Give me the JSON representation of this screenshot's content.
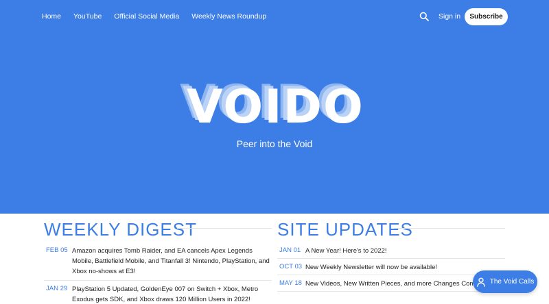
{
  "nav": {
    "links": [
      {
        "label": "Home"
      },
      {
        "label": "YouTube"
      },
      {
        "label": "Official Social Media"
      },
      {
        "label": "Weekly News Roundup"
      }
    ],
    "search_icon": "search-icon",
    "signin_label": "Sign in",
    "subscribe_label": "Subscribe"
  },
  "hero": {
    "logo_text": "VOIDO",
    "tagline": "Peer into the Void",
    "background_color": "#3d7ee6"
  },
  "digest": {
    "title": "WEEKLY DIGEST",
    "items": [
      {
        "date": "FEB 05",
        "text": "Amazon acquires Tomb Raider, and EA cancels Apex Legends Mobile, Battlefield Mobile, and Titanfall 3! Nintendo, PlayStation, and Xbox no-shows at E3!"
      },
      {
        "date": "JAN 29",
        "text": "PlayStation 5 Updated, GoldenEye 007 on Switch + Xbox, Metro Exodus gets SDK, and Xbox draws 120 Million Users in 2022!"
      }
    ]
  },
  "updates": {
    "title": "SITE UPDATES",
    "items": [
      {
        "date": "JAN 01",
        "text": "A New Year! Here's to 2022!"
      },
      {
        "date": "OCT 03",
        "text": "New Weekly Newsletter will now be available!"
      },
      {
        "date": "MAY 18",
        "text": "New Videos, New Written Pieces, and more Changes Coming"
      }
    ]
  },
  "portal": {
    "label": "The Void Calls",
    "icon": "person-icon"
  },
  "colors": {
    "accent": "#3d7ee6",
    "text": "#222222"
  }
}
